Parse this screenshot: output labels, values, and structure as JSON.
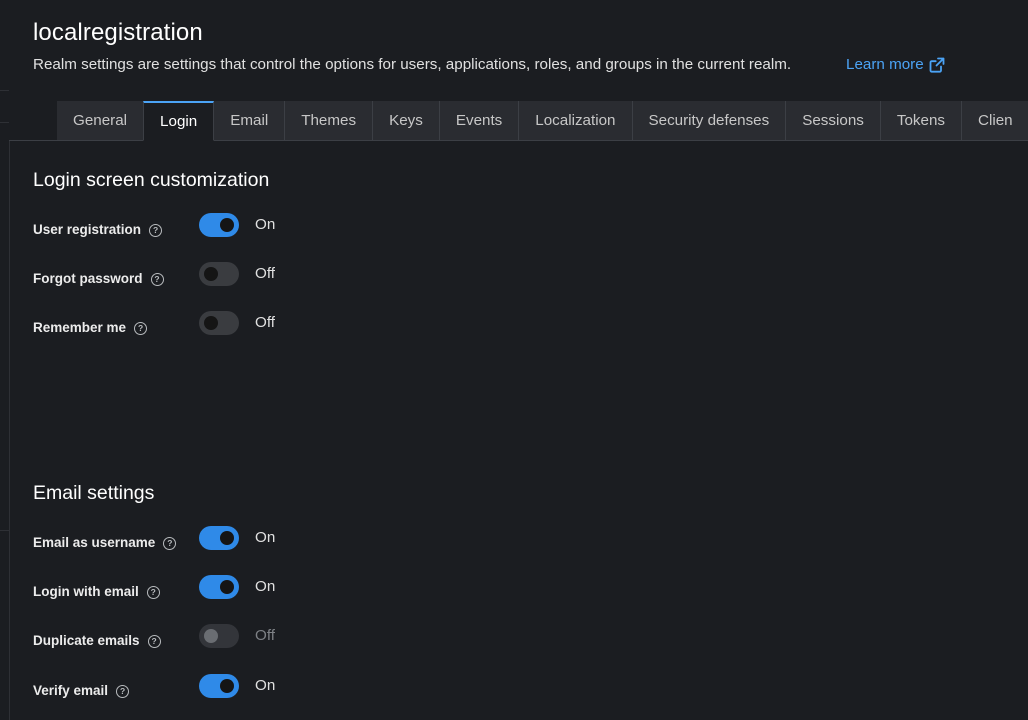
{
  "header": {
    "title": "localregistration",
    "description": "Realm settings are settings that control the options for users, applications, roles, and groups in the current realm.",
    "learn_more": "Learn more",
    "learn_more_icon": "external-link-icon"
  },
  "tabs": [
    {
      "label": "General"
    },
    {
      "label": "Login",
      "active": true
    },
    {
      "label": "Email"
    },
    {
      "label": "Themes"
    },
    {
      "label": "Keys"
    },
    {
      "label": "Events"
    },
    {
      "label": "Localization"
    },
    {
      "label": "Security defenses"
    },
    {
      "label": "Sessions"
    },
    {
      "label": "Tokens"
    },
    {
      "label": "Clien"
    }
  ],
  "login_section": {
    "title": "Login screen customization",
    "items": [
      {
        "label": "User registration",
        "state": "On"
      },
      {
        "label": "Forgot password",
        "state": "Off"
      },
      {
        "label": "Remember me",
        "state": "Off"
      }
    ]
  },
  "email_section": {
    "title": "Email settings",
    "items": [
      {
        "label": "Email as username",
        "state": "On"
      },
      {
        "label": "Login with email",
        "state": "On"
      },
      {
        "label": "Duplicate emails",
        "state": "Off"
      },
      {
        "label": "Verify email",
        "state": "On"
      }
    ]
  },
  "colors": {
    "accent": "#4ba3f5",
    "switch_on": "#2f8ae8",
    "background": "#1b1d21"
  },
  "icons": {
    "help": "help-circle-icon"
  }
}
